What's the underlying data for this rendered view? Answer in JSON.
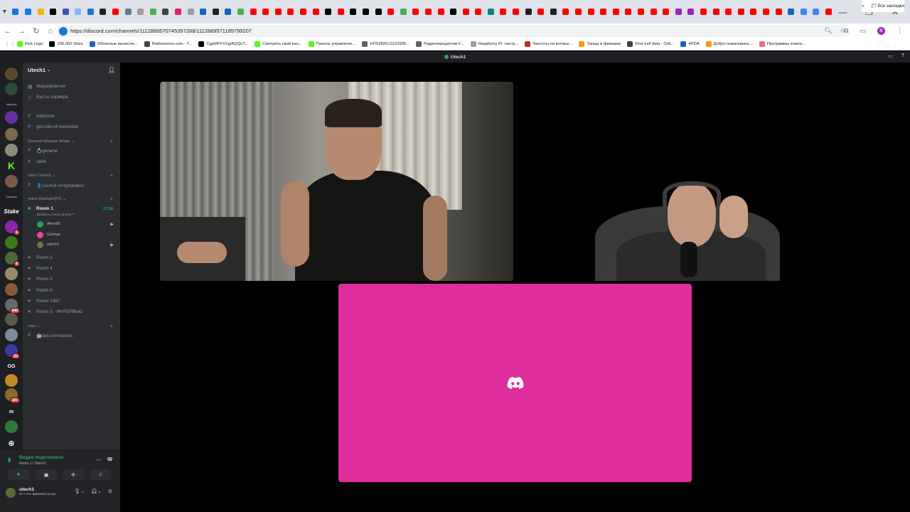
{
  "browser": {
    "url": "https://discord.com/channels/1112889570745397288/1112889571185799207",
    "tab_colors": [
      "#1a73e8",
      "#1877f2",
      "#f4b400",
      "#000000",
      "#3f51b5",
      "#8ab4f8",
      "#1976d2",
      "#202124",
      "#ff0000",
      "#607d8b",
      "#9e9e9e",
      "#4caf50",
      "#424242",
      "#e91e63",
      "#9e9e9e",
      "#1565c0",
      "#202124",
      "#1565c0",
      "#4caf50",
      "#ff0000",
      "#ff0000",
      "#ff0000",
      "#ff0000",
      "#ff0000",
      "#ff0000",
      "#000000",
      "#ff0000",
      "#000000",
      "#000000",
      "#000000",
      "#ff0000",
      "#4caf50",
      "#ff0000",
      "#ff0000",
      "#ff0000",
      "#000000",
      "#ff0000",
      "#ff0000",
      "#00897b",
      "#ff0000",
      "#ff0000",
      "#202124",
      "#ff0000",
      "#202124",
      "#ff0000",
      "#ff0000",
      "#ff0000",
      "#ff0000",
      "#ff0000",
      "#ff0000",
      "#ff0000",
      "#ff0000",
      "#ff0000",
      "#9c27b0",
      "#9c27b0",
      "#ff0000",
      "#ff0000",
      "#ff0000",
      "#ff0000",
      "#ff0000",
      "#ff0000",
      "#ff0000",
      "#1565c0",
      "#4285f4",
      "#4285f4",
      "#ff0000",
      "#ff0000",
      "#ff0000",
      "#ff0000",
      "#ff0000",
      "#ff0000",
      "#4caf50",
      "#ff0000",
      "#00c853"
    ],
    "bookmarks": [
      {
        "label": "Kick Logo",
        "color": "#53fc18"
      },
      {
        "label": "100,000 Stars",
        "color": "#000000"
      },
      {
        "label": "Облачные вычисле...",
        "color": "#1565c0"
      },
      {
        "label": "Radioooooo.com - T...",
        "color": "#424242"
      },
      {
        "label": "CgpMFFXXgIAQQuT...",
        "color": "#000000"
      },
      {
        "label": "Смотреть свой кан...",
        "color": "#53fc18"
      },
      {
        "label": "Панель управлени...",
        "color": "#53fc18"
      },
      {
        "label": "1476282613122595...",
        "color": "#616161"
      },
      {
        "label": "Радиопередатчик F...",
        "color": "#616161"
      },
      {
        "label": "Raspberry Pi: настр...",
        "color": "#9e9e9e"
      },
      {
        "label": "Частоты на которы...",
        "color": "#c62828"
      },
      {
        "label": "Танцы в фильмах",
        "color": "#ff9800"
      },
      {
        "label": "Find exif data - Onli...",
        "color": "#424242"
      },
      {
        "label": "4PDA",
        "color": "#1565c0"
      },
      {
        "label": "Добро пожаловать...",
        "color": "#ff9800"
      },
      {
        "label": "Программы компа...",
        "color": "#e57373"
      }
    ],
    "all_bookmarks": "Все закладки",
    "profile_letter": "B"
  },
  "discord": {
    "window_title": "Utech1",
    "server_name": "Utech1",
    "top_items": [
      "Мероприятия",
      "Бусты сервера"
    ],
    "channels_top": [
      "welcome",
      "get-role-of-memeber"
    ],
    "categories": {
      "general": "General tryharder things",
      "valor": "Valor Council",
      "voice": "voice channels😢😐",
      "misc": "misc"
    },
    "channel_general": "💍general",
    "channel_raids": "raids",
    "channel_council": "👤council-of-tryharders",
    "voice_active": {
      "name": "Room 1",
      "time": "17:58",
      "status": "Выбрать статус канала"
    },
    "members": [
      {
        "name": "Alexi86",
        "color": "#23a55a",
        "camera": true
      },
      {
        "name": "George",
        "color": "#eb459e",
        "camera": false
      },
      {
        "name": "utech1",
        "color": "#7a6b4a",
        "camera": true
      }
    ],
    "voice_rooms": [
      "Room 2",
      "Room 4",
      "Room 5",
      "Room 6",
      "Room 1487",
      "Room 3 - ИНТЕРВЬЮ"
    ],
    "channel_bot": "🤖bot-commands",
    "voice_panel": {
      "status": "Видео подключено",
      "sub": "Room 1 / Utech1"
    },
    "user": {
      "name": "utech1",
      "sub": "ID • Нет времени на ра..."
    },
    "server_labels": [
      "Админы",
      "Эрмерик"
    ],
    "server_badges": [
      "6",
      "540",
      "22",
      "197"
    ],
    "server_letters": [
      "GG",
      "m"
    ],
    "server_stake": "Stake"
  }
}
